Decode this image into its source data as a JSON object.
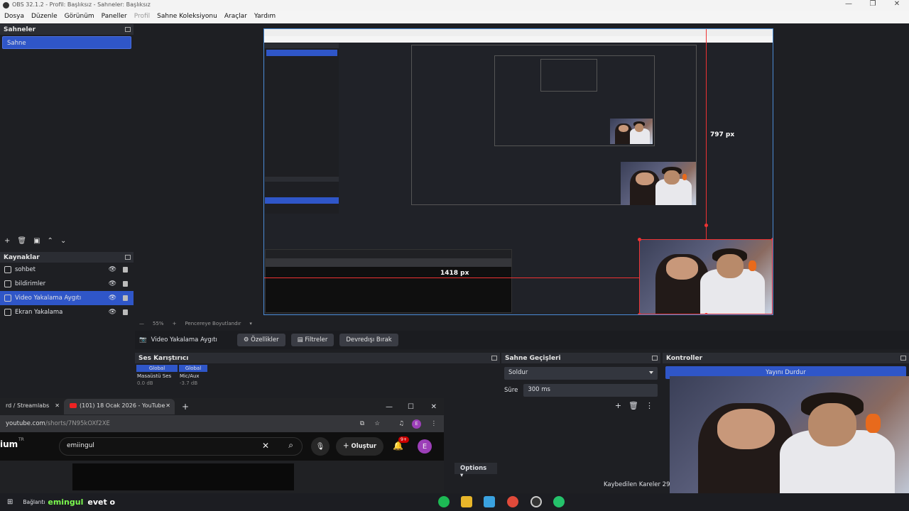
{
  "window": {
    "title": "OBS 32.1.2 - Profil: Başlıksız - Sahneler: Başlıksız",
    "controls": [
      "—",
      "❐",
      "✕"
    ]
  },
  "menubar": {
    "items": [
      "Dosya",
      "Düzenle",
      "Görünüm",
      "Paneller",
      "Profil",
      "Sahne Koleksiyonu",
      "Araçlar",
      "Yardım"
    ]
  },
  "scenes": {
    "title": "Sahneler",
    "items": [
      "Sahne"
    ]
  },
  "sources": {
    "title": "Kaynaklar",
    "items": [
      "sohbet",
      "bildirimler",
      "Video Yakalama Aygıtı",
      "Ekran Yakalama"
    ]
  },
  "preview": {
    "measure_vertical": "797 px",
    "measure_horizontal": "1418 px",
    "zoom": "55%",
    "fit_label": "Pencereye Boyutlandır"
  },
  "properties_bar": {
    "source_name": "Video Yakalama Aygıtı",
    "properties_btn": "Özellikler",
    "filters_btn": "Filtreler",
    "deactivate_btn": "Devredışı Bırak"
  },
  "mixer": {
    "title": "Ses Karıştırıcı",
    "channels": [
      {
        "scope": "Global",
        "name": "Masaüstü Ses",
        "db": "0.0 dB"
      },
      {
        "scope": "Global",
        "name": "Mic/Aux",
        "db": "-3.7 dB"
      }
    ]
  },
  "transitions": {
    "title": "Sahne Geçişleri",
    "selected": "Soldur",
    "duration_label": "Süre",
    "duration_value": "300 ms"
  },
  "controls": {
    "title": "Kontroller",
    "stop_stream": "Yayını Durdur"
  },
  "status": {
    "dropped_frames": "Kaybedilen Kareler 29"
  },
  "browser": {
    "tab1": "rd / Streamlabs",
    "tab2": "(101) 18 Ocak 2026 - YouTube",
    "url_host": "youtube.com",
    "url_path": "/shorts/7N95kOXf2XE",
    "brand": "ium",
    "brand_sup": "TR",
    "search_value": "emiingul",
    "create_label": "Oluştur",
    "notif_badge": "9+",
    "avatar_letter": "E",
    "options_label": "Options"
  },
  "taskbar": {
    "connected": "Bağlantı",
    "chat_user": "emingul",
    "chat_msg": "evet o"
  },
  "colors": {
    "accent": "#2f56c8",
    "selection_red": "#e33333",
    "panel_bg": "#1e1f23"
  }
}
